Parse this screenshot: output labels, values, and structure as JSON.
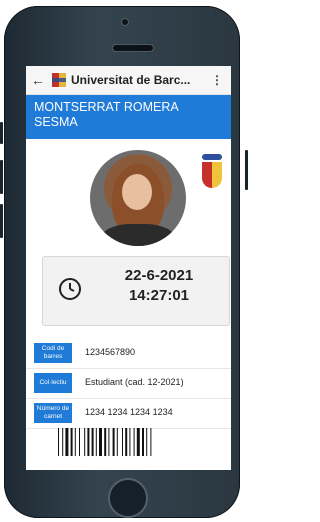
{
  "app": {
    "title": "Universitat de Barc...",
    "back_icon": "back-arrow-icon",
    "menu_icon": "more-vertical-icon"
  },
  "user": {
    "full_name": "MONTSERRAT ROMERA SESMA"
  },
  "card": {
    "date": "22-6-2021",
    "time": "14:27:01"
  },
  "fields": [
    {
      "label": "Codi de barres",
      "value": "1234567890"
    },
    {
      "label": "Col·lectiu",
      "value": "Estudiant (cad. 12-2021)"
    },
    {
      "label": "Número de carnet",
      "value": "1234 1234 1234 1234"
    }
  ],
  "colors": {
    "accent": "#1f7ad8",
    "header_bg": "#f6f6f6"
  }
}
